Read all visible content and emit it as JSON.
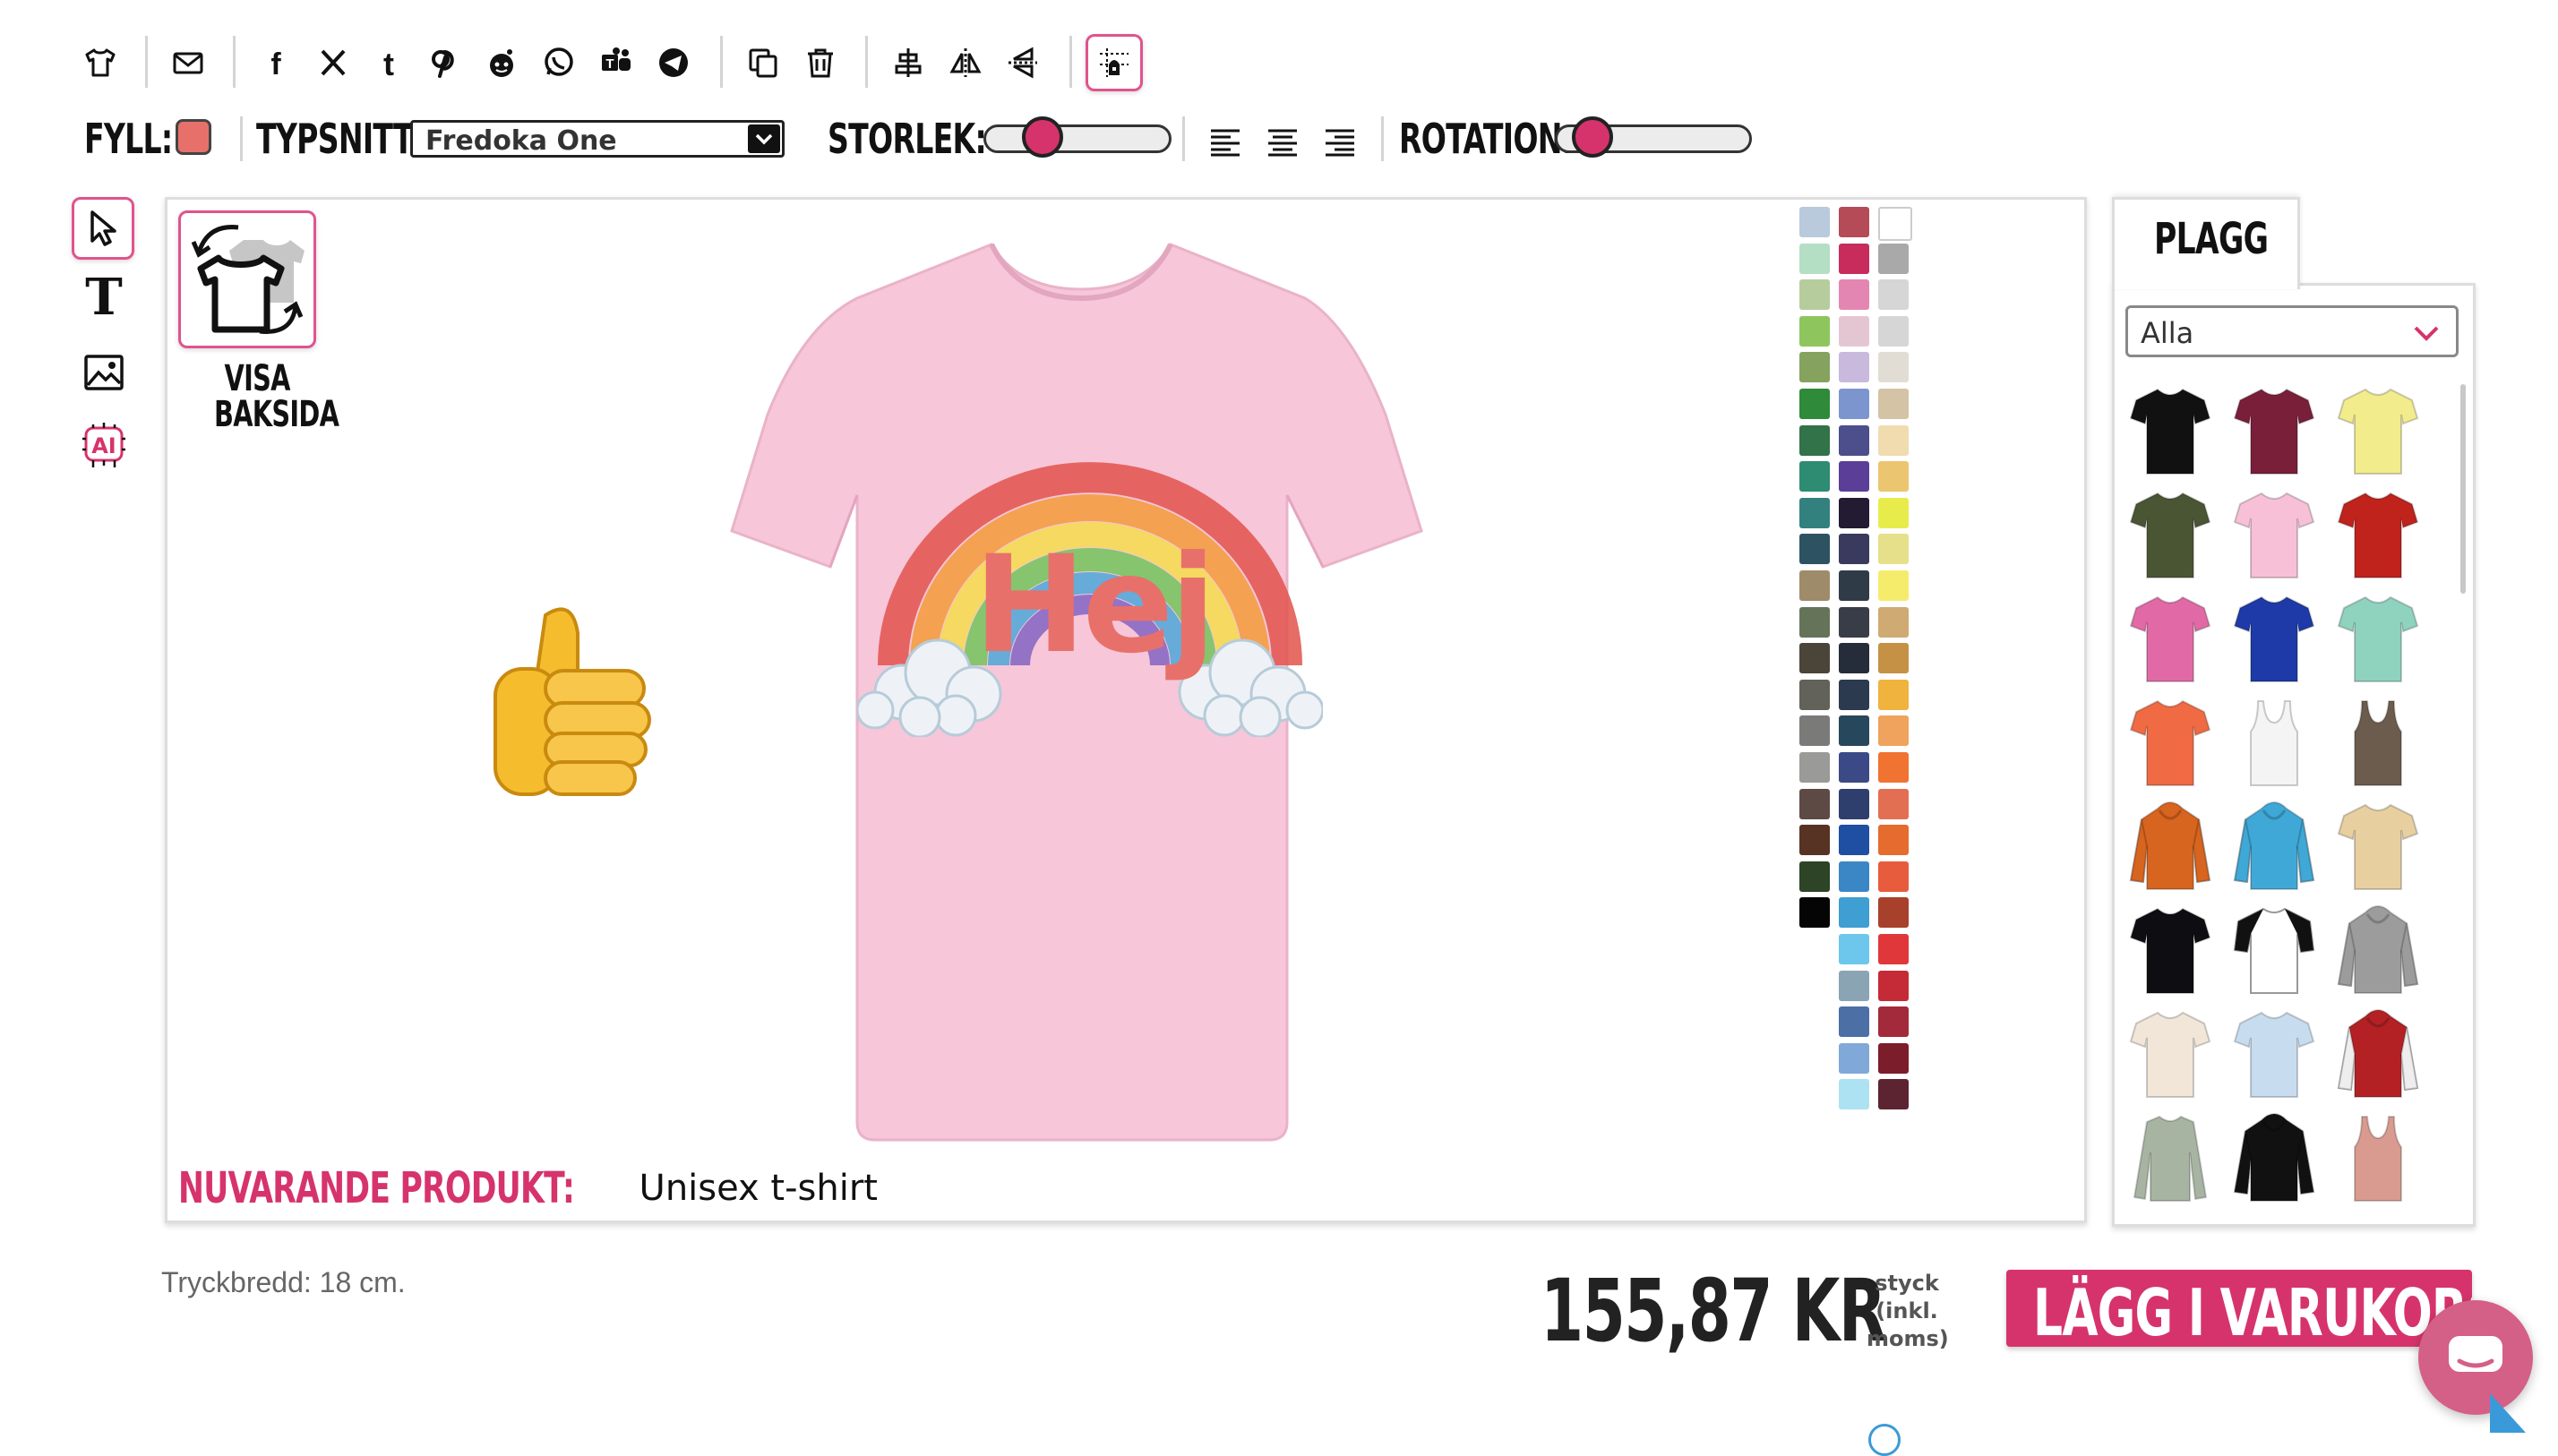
{
  "toolbar": {
    "icons": [
      {
        "name": "tshirt-icon"
      },
      {
        "name": "mail-icon"
      },
      {
        "name": "facebook-icon"
      },
      {
        "name": "x-icon"
      },
      {
        "name": "tumblr-icon"
      },
      {
        "name": "pinterest-icon"
      },
      {
        "name": "reddit-icon"
      },
      {
        "name": "whatsapp-icon"
      },
      {
        "name": "teams-icon"
      },
      {
        "name": "telegram-icon"
      },
      {
        "name": "duplicate-icon"
      },
      {
        "name": "delete-icon"
      },
      {
        "name": "center-icon"
      },
      {
        "name": "flip-horizontal-icon"
      },
      {
        "name": "flip-vertical-icon"
      },
      {
        "name": "layer-icon"
      }
    ]
  },
  "properties": {
    "fill_label": "FYLL:",
    "fill_color": "#e8706a",
    "font_label": "TYPSNITT:",
    "font_value": "Fredoka One",
    "size_label": "STORLEK:",
    "size_slider_value": 0.25,
    "rotation_label": "ROTATION:",
    "rotation_slider_value": 0.1
  },
  "tools": [
    {
      "name": "select-tool-icon"
    },
    {
      "name": "text-tool-icon"
    },
    {
      "name": "image-tool-icon"
    },
    {
      "name": "ai-tool-icon"
    }
  ],
  "back_side": {
    "line1": "VISA",
    "line2": "BAKSIDA"
  },
  "design": {
    "text": "Hej",
    "text_color": "#e8706a"
  },
  "current_product": {
    "label": "NUVARANDE PRODUKT:",
    "value": "Unisex t-shirt"
  },
  "shirt_color": "#f7c6d9",
  "swatches": {
    "col1": [
      "#b8cadb",
      "#b5dfc4",
      "#b7cc9c",
      "#8ec65d",
      "#85a35f",
      "#2f8a3a",
      "#327349",
      "#2d8c72",
      "#33817f",
      "#2d5362",
      "#9e8b6a",
      "#657459",
      "#4b4438",
      "#62615a",
      "#7a7a79",
      "#9a9a99",
      "#5d4a45",
      "#573323",
      "#2d4427",
      "#050505"
    ],
    "col2": [
      "#b44b56",
      "#c72c5c",
      "#e486b2",
      "#e4c6d3",
      "#c9b9dc",
      "#7c95cf",
      "#4c4f8b",
      "#5b3e97",
      "#231b31",
      "#393a5e",
      "#2f3c48",
      "#393d47",
      "#252c3a",
      "#2c3a4f",
      "#27475c",
      "#3b4a86",
      "#2e3f6e",
      "#1e4fa2",
      "#3b87c6",
      "#3f9ed2",
      "#6dc7ec",
      "#8aa4b4",
      "#4c6fa6",
      "#80a9da",
      "#ace2f1"
    ],
    "col3": [
      "#ffffff",
      "#a9a9a9",
      "#d6d6d6",
      "#d6d6d6",
      "#e2ddd4",
      "#d4c3a4",
      "#f0dcae",
      "#ecc570",
      "#e8ec4a",
      "#e6e08a",
      "#f5ec6c",
      "#cfaa72",
      "#c59145",
      "#efb33e",
      "#f0a35c",
      "#f07331",
      "#e36f53",
      "#e56b2f",
      "#e85c3e",
      "#a8412b",
      "#e0383a",
      "#c52a37",
      "#a32a3a",
      "#7c1d2b",
      "#5c2431"
    ]
  },
  "panel": {
    "tab_label": "PLAGG",
    "filter_value": "Alla",
    "products": [
      {
        "name": "black-tshirt",
        "color": "#111111",
        "kind": "tee"
      },
      {
        "name": "maroon-tshirt",
        "color": "#7a1f3a",
        "kind": "tee"
      },
      {
        "name": "yellow-tshirt",
        "color": "#f3ec8c",
        "kind": "tee"
      },
      {
        "name": "olive-tshirt",
        "color": "#4a5534",
        "kind": "tee"
      },
      {
        "name": "pink-ladies-tshirt",
        "color": "#f8c0d6",
        "kind": "tee"
      },
      {
        "name": "red-tshirt",
        "color": "#c0221c",
        "kind": "tee"
      },
      {
        "name": "magenta-ladies-tshirt",
        "color": "#e16aa6",
        "kind": "tee"
      },
      {
        "name": "royal-tshirt",
        "color": "#1e3aa8",
        "kind": "tee"
      },
      {
        "name": "mint-tshirt",
        "color": "#8fd2be",
        "kind": "tee"
      },
      {
        "name": "coral-tshirt",
        "color": "#f06a44",
        "kind": "tee"
      },
      {
        "name": "white-tank",
        "color": "#f4f4f4",
        "kind": "tank"
      },
      {
        "name": "brown-tank",
        "color": "#6b5c4d",
        "kind": "tank"
      },
      {
        "name": "orange-hoodie",
        "color": "#d7641f",
        "kind": "hoodie"
      },
      {
        "name": "sky-hoodie",
        "color": "#3fa8d6",
        "kind": "hoodie"
      },
      {
        "name": "tiedye-tshirt",
        "color": "#e7cfa0",
        "kind": "tee"
      },
      {
        "name": "black-vneck",
        "color": "#0e0e12",
        "kind": "tee"
      },
      {
        "name": "raglan-tshirt",
        "color": "#ffffff",
        "kind": "raglan"
      },
      {
        "name": "grey-hoodie",
        "color": "#9c9c9c",
        "kind": "hoodie"
      },
      {
        "name": "cream-tshirt",
        "color": "#f1e6d8",
        "kind": "tee"
      },
      {
        "name": "ombre-tshirt",
        "color": "#c8dcf0",
        "kind": "tee"
      },
      {
        "name": "varsity-jacket",
        "color": "#b42125",
        "kind": "jacket"
      },
      {
        "name": "sage-longsleeve",
        "color": "#a7b4a2",
        "kind": "longsleeve"
      },
      {
        "name": "black-orange-hoodie",
        "color": "#111111",
        "kind": "hoodie"
      },
      {
        "name": "rose-tank",
        "color": "#d99a8f",
        "kind": "tank"
      }
    ]
  },
  "footer": {
    "print_width": "Tryckbredd: 18 cm.",
    "price": "155,87 KR",
    "price_note_1": "styck",
    "price_note_2": "(inkl.",
    "price_note_3": "moms)",
    "cart_button": "LÄGG I VARUKORGEN"
  }
}
